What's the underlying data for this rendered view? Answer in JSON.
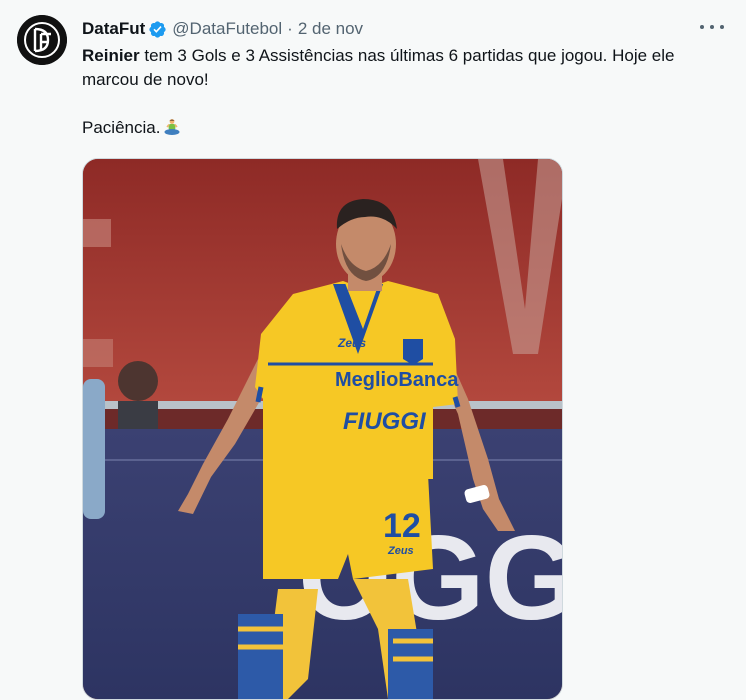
{
  "tweet": {
    "author_name": "DataFut",
    "author_handle": "@DataFutebol",
    "separator": "·",
    "date": "2 de nov",
    "verified": true,
    "avatar_icon": "datafut-logo-icon",
    "more_icon": "more-options-icon",
    "text": {
      "bold_name": "Reinier",
      "line1_rest": " tem 3 Gols e 3 Assistências nas últimas 6 partidas que jogou. Hoje ele marcou de novo!",
      "line2": "Paciência.",
      "emoji": "person-in-lotus-position-emoji"
    },
    "media": {
      "jersey_number": "12",
      "sponsor_main": "MeglioBanca",
      "sponsor_front": "FIUGGI",
      "brand": "Zeus",
      "billboard_text": "OGG"
    }
  },
  "colors": {
    "background": "#f7f9f9",
    "text_primary": "#0f1419",
    "text_secondary": "#536471",
    "verified_blue": "#1d9bf0",
    "kit_yellow": "#f6c825",
    "kit_blue": "#1f4ea3"
  }
}
